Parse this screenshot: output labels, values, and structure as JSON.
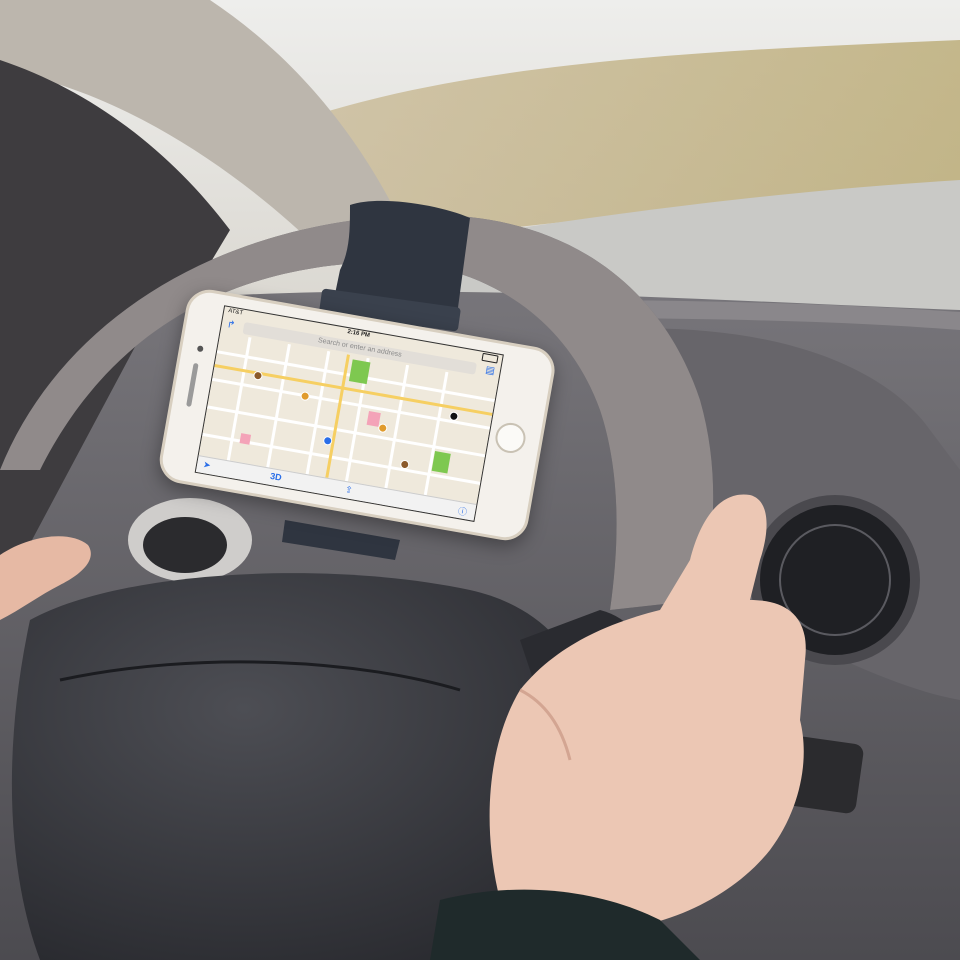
{
  "phone": {
    "status": {
      "carrier": "AT&T",
      "time": "2:16 PM"
    },
    "search": {
      "placeholder": "Search or enter an address"
    },
    "toolbar": {
      "three_d": "3D"
    }
  },
  "colors": {
    "sky": "#e9e9e6",
    "dashboard": "#6e6c6d",
    "wheel": "#8d8685",
    "map_bg": "#efe9dc",
    "accent": "#2a6ee8",
    "park": "#7ec850"
  },
  "icons": [
    "location-arrow-icon",
    "share-icon",
    "info-icon",
    "list-icon",
    "turn-arrow-icon"
  ]
}
